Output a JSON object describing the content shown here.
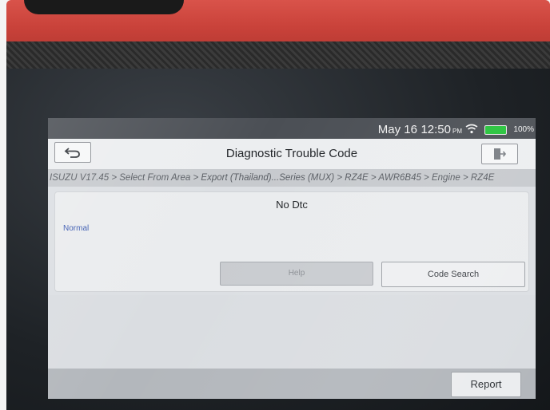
{
  "status_bar": {
    "date": "May 16",
    "time": "12:50",
    "ampm": "PM",
    "battery": "100%",
    "battery_color": "#25c33a"
  },
  "header": {
    "title": "Diagnostic Trouble Code",
    "back_icon": "back-arrow-icon",
    "exit_icon": "exit-icon"
  },
  "breadcrumb": "ISUZU V17.45 > Select From Area > Export (Thailand)...Series (MUX) > RZ4E > AWR6B45 > Engine > RZ4E",
  "dtc_panel": {
    "title": "No Dtc",
    "status": "Normal",
    "status_color": "#3a59b0"
  },
  "buttons": {
    "help": "Help",
    "code_search": "Code Search",
    "report": "Report"
  },
  "colors": {
    "device_red": "#c9423a",
    "title_bar": "#eceef0"
  }
}
